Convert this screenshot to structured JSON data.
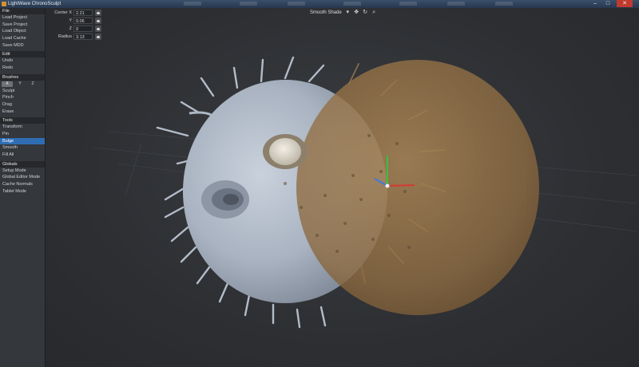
{
  "window": {
    "title": "LightWave ChronoSculpt",
    "minimize": "–",
    "maximize": "□",
    "close": "✕"
  },
  "sidebar": {
    "file": {
      "header": "File",
      "items": [
        "Load Project",
        "Save Project",
        "Load Object",
        "Load Cache",
        "Save MDD"
      ]
    },
    "edit": {
      "header": "Edit",
      "items": [
        "Undo",
        "Redo"
      ]
    },
    "brushes": {
      "header": "Brushes",
      "axes": [
        "X",
        "Y",
        "Z"
      ],
      "items": [
        "Sculpt",
        "Pinch",
        "Drag",
        "Erase"
      ]
    },
    "tools": {
      "header": "Tools",
      "items": [
        "Transform",
        "Pin",
        "Bulge",
        "Smooth",
        "Fill All"
      ],
      "active": "Bulge"
    },
    "globals": {
      "header": "Globals",
      "items": [
        "Setup Mode",
        "Global Editor Mode",
        "Cache Normals",
        "Tablet Mode"
      ]
    }
  },
  "properties": {
    "rows": [
      {
        "label": "Center X",
        "value": "2.21"
      },
      {
        "label": "Y",
        "value": "0.06"
      },
      {
        "label": "Z",
        "value": "0"
      },
      {
        "label": "Radius",
        "value": "3.13"
      }
    ]
  },
  "toolbar": {
    "shading_mode": "Smooth Shade",
    "icons": [
      "chevron-down-icon",
      "move-icon",
      "rotate-icon",
      "zoom-icon"
    ]
  },
  "colors": {
    "accent": "#2f6db3",
    "model": "#aeb8c6",
    "brush_sphere": "#9b7a4e"
  }
}
